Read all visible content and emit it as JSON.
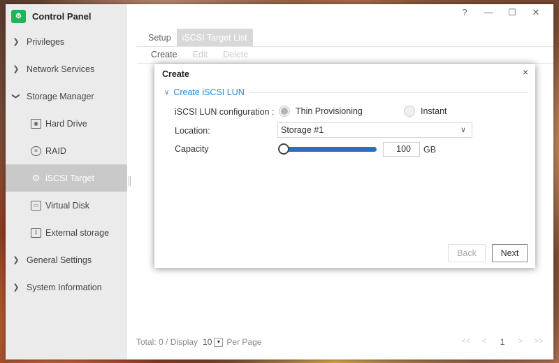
{
  "app": {
    "title": "Control Panel",
    "logo_icon": "control-panel-icon"
  },
  "window_controls": [
    "?",
    "—",
    "☐",
    "✕"
  ],
  "sidebar": {
    "items": [
      {
        "label": "Privileges",
        "type": "group"
      },
      {
        "label": "Network Services",
        "type": "group"
      },
      {
        "label": "Storage Manager",
        "type": "group-open"
      },
      {
        "label": "Hard Drive",
        "type": "sub",
        "icon": "hard-drive-icon"
      },
      {
        "label": "RAID",
        "type": "sub",
        "icon": "raid-icon"
      },
      {
        "label": "iSCSI Target",
        "type": "sub",
        "icon": "iscsi-icon",
        "active": true
      },
      {
        "label": "Virtual Disk",
        "type": "sub",
        "icon": "virtual-disk-icon"
      },
      {
        "label": "External storage",
        "type": "sub",
        "icon": "external-storage-icon"
      },
      {
        "label": "General Settings",
        "type": "group"
      },
      {
        "label": "System Information",
        "type": "group"
      }
    ]
  },
  "tabs": [
    {
      "label": "Setup",
      "active": false
    },
    {
      "label": "iSCSI Target List",
      "active": true
    }
  ],
  "toolbar": {
    "create": "Create",
    "edit": "Edit",
    "delete": "Delete"
  },
  "footer": {
    "total": "Total: 0 / Display",
    "per_page_value": "10",
    "per_page_label": "Per Page",
    "page": "1",
    "first": "<<",
    "prev": "<",
    "next": ">",
    "last": ">>"
  },
  "dialog": {
    "title": "Create",
    "close": "×",
    "section": "Create iSCSI LUN",
    "config_label": "iSCSI LUN configuration :",
    "option_thin": "Thin Provisioning",
    "option_instant": "Instant",
    "selected_option": "thin",
    "location_label": "Location:",
    "location_value": "Storage #1",
    "capacity_label": "Capacity",
    "capacity_value": "100",
    "capacity_unit": "GB",
    "slider_fraction": 0.0,
    "back": "Back",
    "next": "Next"
  },
  "colors": {
    "accent": "#1e88d6",
    "slider": "#2a6fc2",
    "logo": "#20b45a"
  }
}
